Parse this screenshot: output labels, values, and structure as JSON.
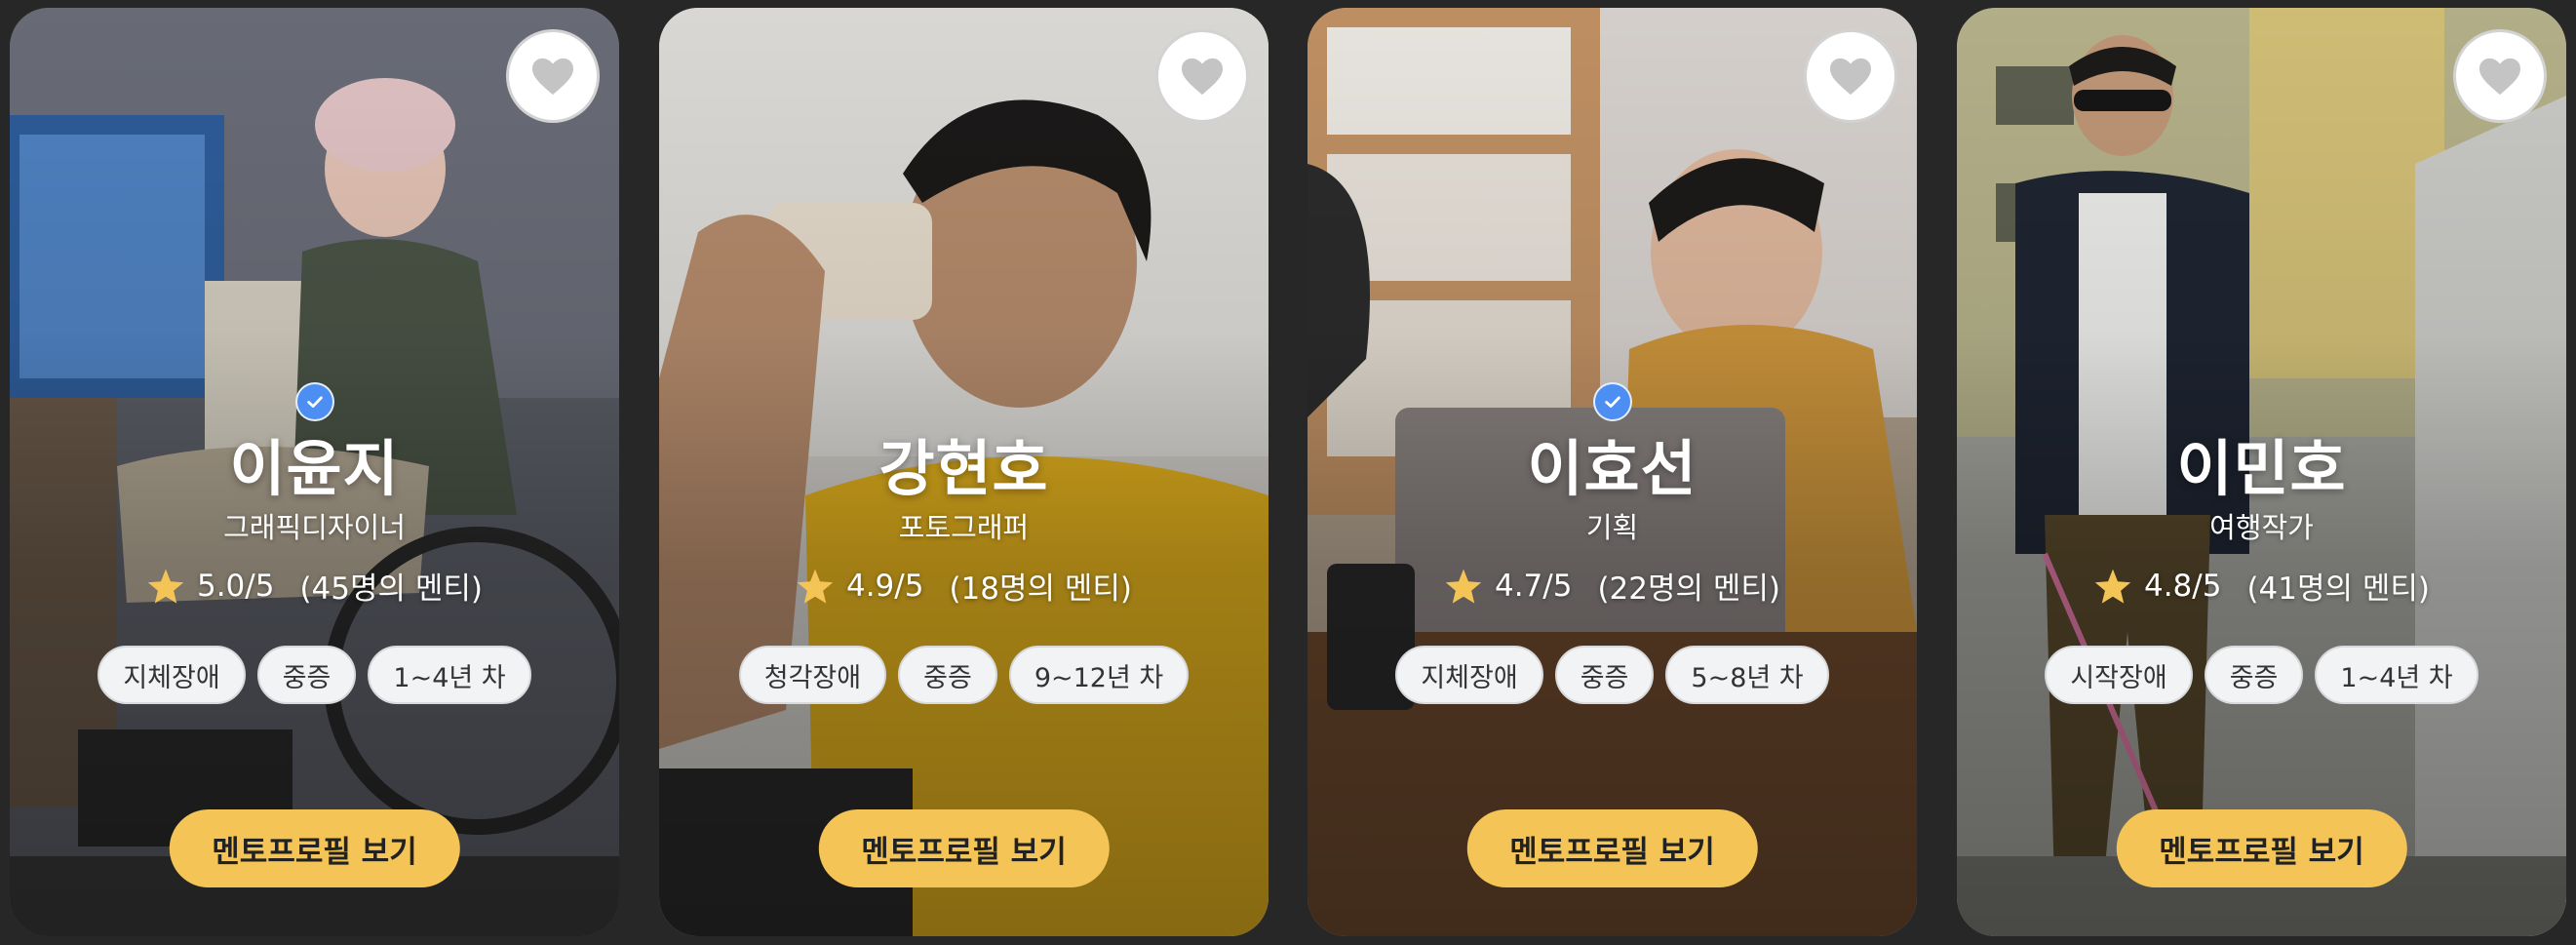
{
  "cta_label": "멘토프로필 보기",
  "colors": {
    "background": "#272727",
    "cta": "#f4c556",
    "verified": "#4c8ef2",
    "star": "#f4c556",
    "tag_bg": "#f2f3f5"
  },
  "mentors": [
    {
      "name": "이윤지",
      "role": "그래픽디자이너",
      "rating": "5.0/5",
      "mentee_count": "(45명의 멘티)",
      "verified": true,
      "tags": [
        "지체장애",
        "중증",
        "1~4년 차"
      ]
    },
    {
      "name": "강현호",
      "role": "포토그래퍼",
      "rating": "4.9/5",
      "mentee_count": "(18명의 멘티)",
      "verified": false,
      "tags": [
        "청각장애",
        "중증",
        "9~12년 차"
      ]
    },
    {
      "name": "이효선",
      "role": "기획",
      "rating": "4.7/5",
      "mentee_count": "(22명의 멘티)",
      "verified": true,
      "tags": [
        "지체장애",
        "중증",
        "5~8년 차"
      ]
    },
    {
      "name": "이민호",
      "role": "여행작가",
      "rating": "4.8/5",
      "mentee_count": "(41명의 멘티)",
      "verified": false,
      "tags": [
        "시작장애",
        "중증",
        "1~4년 차"
      ]
    }
  ]
}
